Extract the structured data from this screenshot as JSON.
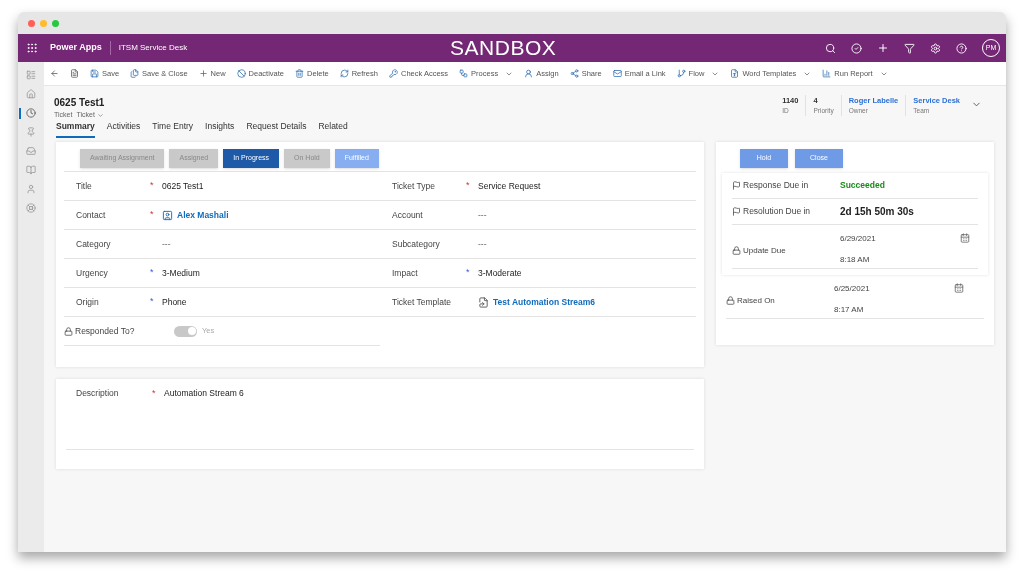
{
  "app_bar": {
    "app_name": "Power Apps",
    "area": "ITSM Service Desk",
    "banner": "SANDBOX",
    "avatar": "PM"
  },
  "nav_items": [
    {
      "selected": false
    },
    {
      "selected": false
    },
    {
      "selected": true
    },
    {
      "selected": false
    },
    {
      "selected": false
    },
    {
      "selected": false
    },
    {
      "selected": false
    },
    {
      "selected": false
    }
  ],
  "toolbar": [
    {
      "label": "Save",
      "dropdown": false
    },
    {
      "label": "Save & Close",
      "dropdown": false
    },
    {
      "label": "New",
      "dropdown": false
    },
    {
      "label": "Deactivate",
      "dropdown": false
    },
    {
      "label": "Delete",
      "dropdown": false
    },
    {
      "label": "Refresh",
      "dropdown": false
    },
    {
      "label": "Check Access",
      "dropdown": false
    },
    {
      "label": "Process",
      "dropdown": true
    },
    {
      "label": "Assign",
      "dropdown": false
    },
    {
      "label": "Share",
      "dropdown": false
    },
    {
      "label": "Email a Link",
      "dropdown": false
    },
    {
      "label": "Flow",
      "dropdown": true
    },
    {
      "label": "Word Templates",
      "dropdown": true
    },
    {
      "label": "Run Report",
      "dropdown": true
    }
  ],
  "record": {
    "title": "0625 Test1",
    "entity": "Ticket",
    "form": "Ticket",
    "header_fields": [
      {
        "value": "1140",
        "label": "ID",
        "link": false
      },
      {
        "value": "4",
        "label": "Priority",
        "link": false
      },
      {
        "value": "Roger Labelle",
        "label": "Owner",
        "link": true
      },
      {
        "value": "Service Desk",
        "label": "Team",
        "link": true
      }
    ]
  },
  "tabs": [
    {
      "label": "Summary",
      "selected": true
    },
    {
      "label": "Activities",
      "selected": false
    },
    {
      "label": "Time Entry",
      "selected": false
    },
    {
      "label": "Insights",
      "selected": false
    },
    {
      "label": "Request Details",
      "selected": false
    },
    {
      "label": "Related",
      "selected": false
    }
  ],
  "status_buttons": [
    {
      "label": "Awaiting Assignment",
      "kind": "disabled"
    },
    {
      "label": "Assigned",
      "kind": "disabled"
    },
    {
      "label": "In Progress",
      "kind": "current"
    },
    {
      "label": "On Hold",
      "kind": "disabled"
    },
    {
      "label": "Fulfilled",
      "kind": "available"
    }
  ],
  "fields_left": [
    {
      "label": "Title",
      "marker": "*",
      "required": true,
      "value": "0625 Test1",
      "kind": "text"
    },
    {
      "label": "Contact",
      "marker": "*",
      "required": true,
      "value": "Alex Mashali",
      "kind": "contact"
    },
    {
      "label": "Category",
      "value": "---",
      "kind": "empty"
    },
    {
      "label": "Urgency",
      "marker": "*",
      "required": false,
      "value": "3-Medium",
      "kind": "text"
    },
    {
      "label": "Origin",
      "marker": "*",
      "required": false,
      "value": "Phone",
      "kind": "text"
    }
  ],
  "fields_right": [
    {
      "label": "Ticket Type",
      "marker": "*",
      "required": true,
      "value": "Service Request",
      "kind": "text"
    },
    {
      "label": "Account",
      "value": "---",
      "kind": "empty"
    },
    {
      "label": "Subcategory",
      "value": "---",
      "kind": "empty"
    },
    {
      "label": "Impact",
      "marker": "*",
      "required": false,
      "value": "3-Moderate",
      "kind": "text"
    },
    {
      "label": "Ticket Template",
      "value": "Test Automation Stream6",
      "kind": "template"
    }
  ],
  "responded": {
    "label": "Responded To?",
    "on": true,
    "disabled": true,
    "value": "Yes"
  },
  "side_buttons": [
    {
      "label": "Hold"
    },
    {
      "label": "Close"
    }
  ],
  "sla": [
    {
      "label": "Response Due in",
      "kind": "flag",
      "value": "Succeeded",
      "color": "#1a8a1a"
    },
    {
      "label": "Resolution Due in",
      "kind": "flag",
      "value": "2d 15h 50m 30s",
      "color": "#222222"
    }
  ],
  "dates": [
    {
      "label": "Update Due",
      "date": "6/29/2021",
      "time": "8:18 AM"
    },
    {
      "label": "Raised On",
      "date": "6/25/2021",
      "time": "8:17 AM"
    }
  ],
  "description": {
    "label": "Description",
    "marker": "*",
    "required": true,
    "value": "Automation Stream 6"
  }
}
